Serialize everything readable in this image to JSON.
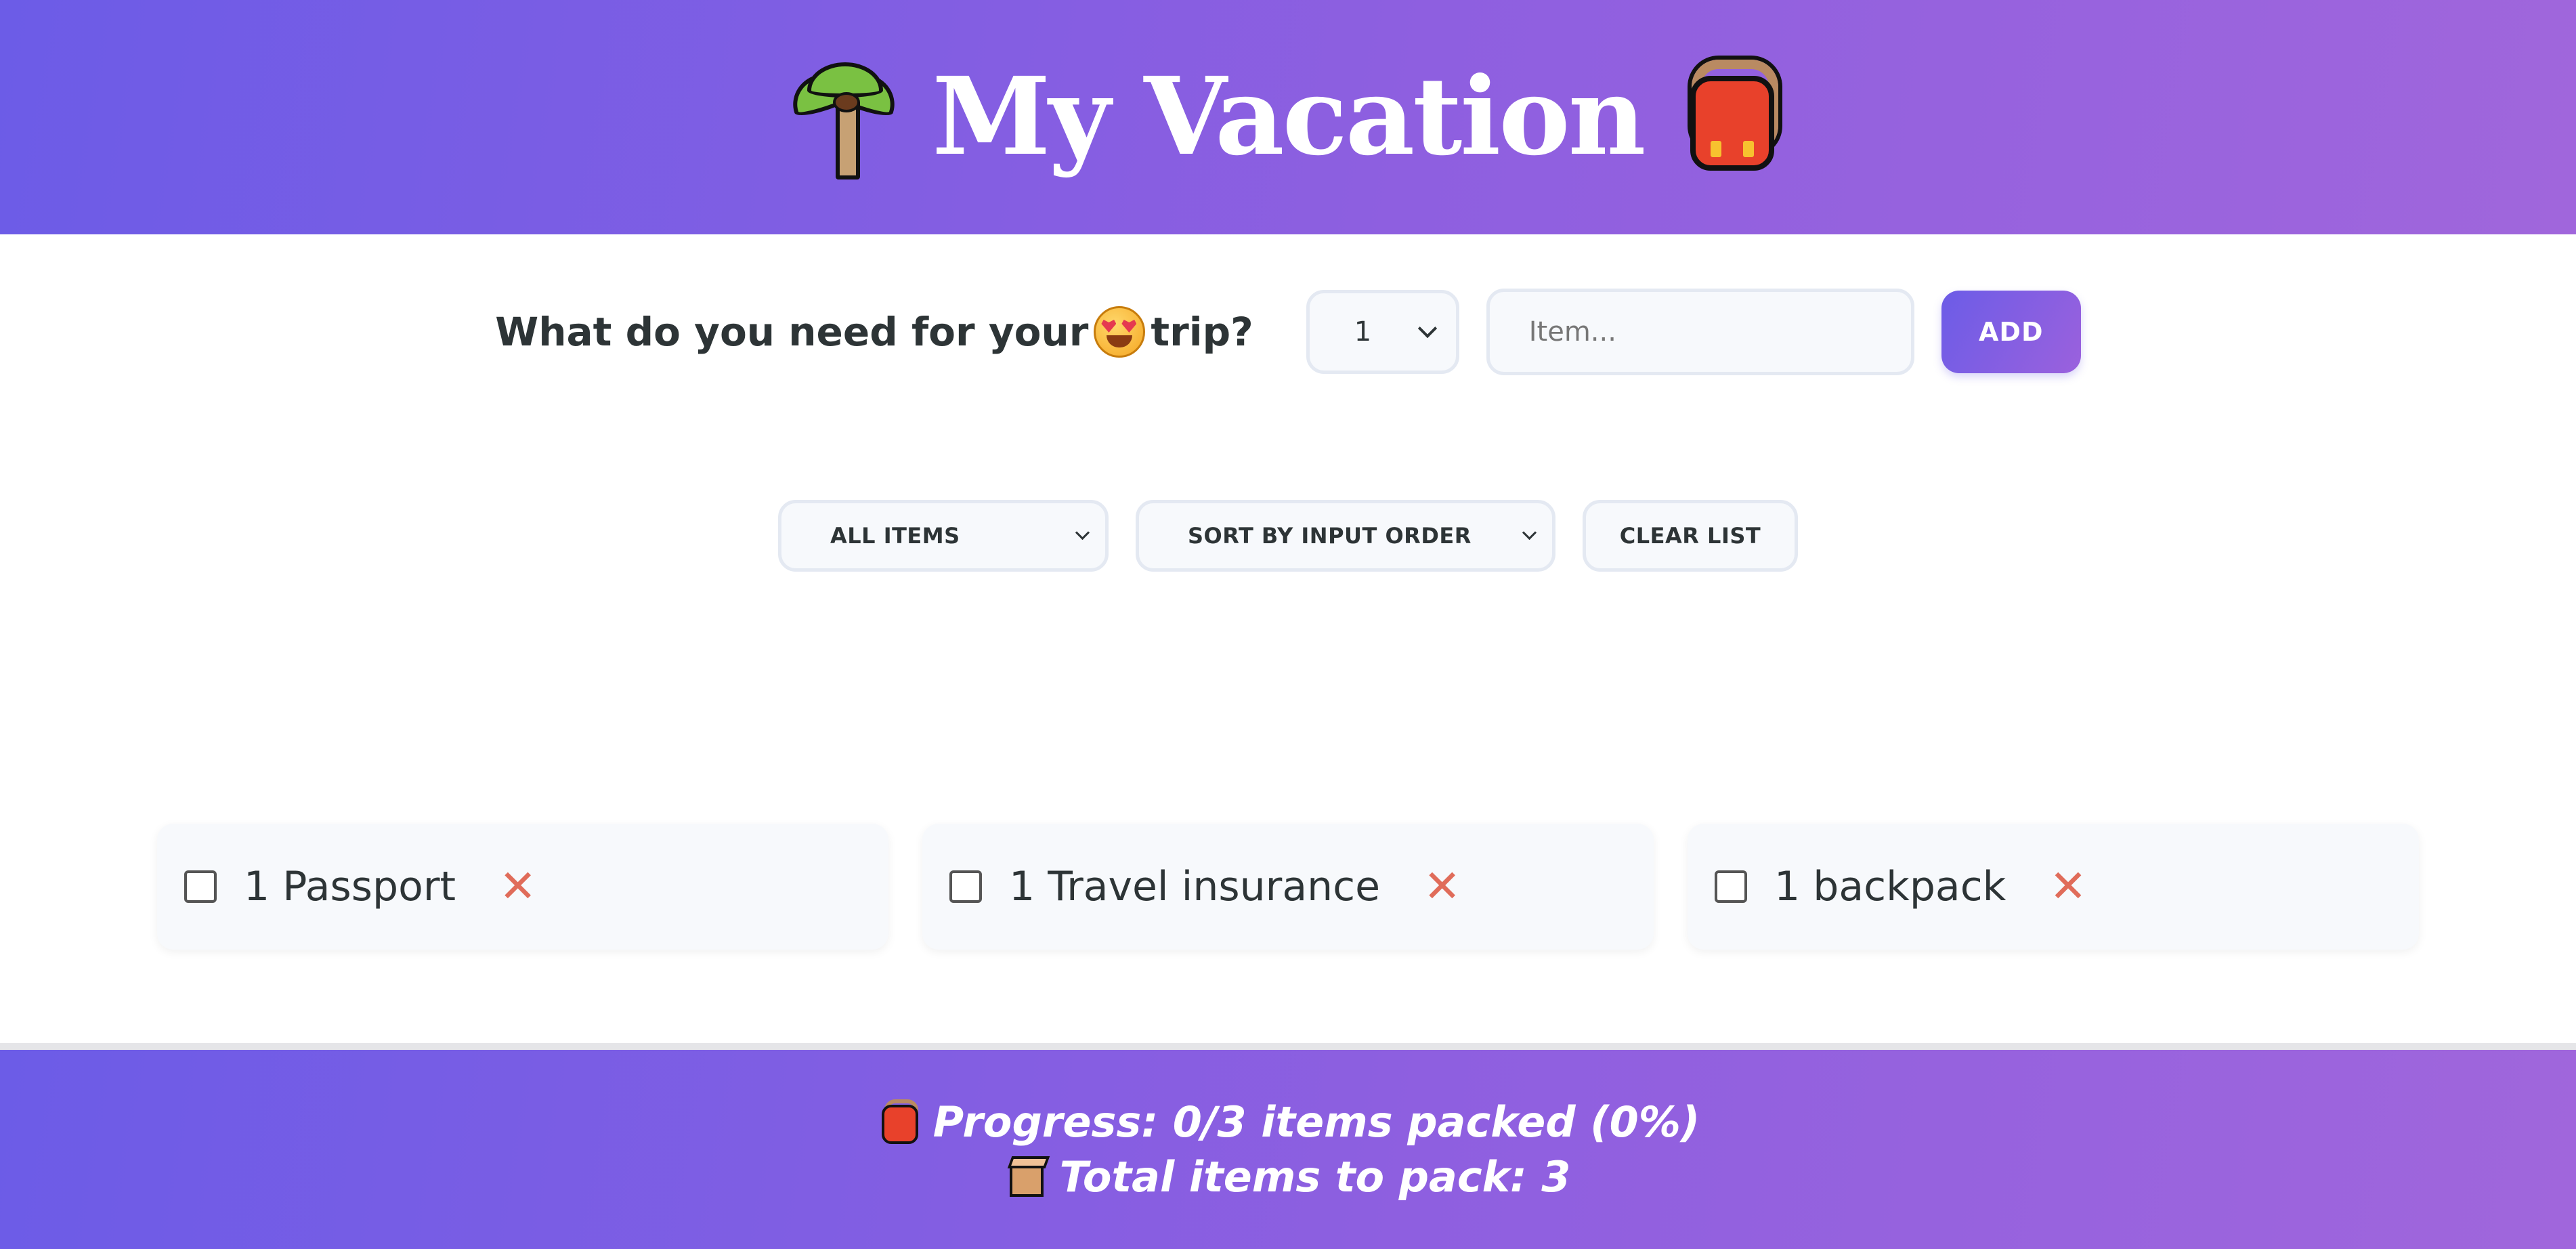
{
  "header": {
    "title": "My Vacation",
    "left_icon": "palm-tree-icon",
    "right_icon": "backpack-icon"
  },
  "add_form": {
    "question_before": "What do you need for your",
    "question_emoji": "heart-eyes-emoji-icon",
    "question_after": "trip?",
    "quantity_selected": "1",
    "item_placeholder": "Item...",
    "add_label": "ADD"
  },
  "actions": {
    "filter_selected": "ALL ITEMS",
    "sort_selected": "SORT BY INPUT ORDER",
    "clear_label": "CLEAR LIST"
  },
  "items": [
    {
      "text": "1 Passport",
      "packed": false
    },
    {
      "text": "1 Travel insurance",
      "packed": false
    },
    {
      "text": "1 backpack",
      "packed": false
    }
  ],
  "stats": {
    "progress": "Progress: 0/3 items packed (0%)",
    "total": "Total items to pack: 3"
  },
  "colors": {
    "gradient_start": "#6c5ce7",
    "gradient_end": "#a066dc",
    "delete": "#e06c5a",
    "text": "#2d3436"
  }
}
